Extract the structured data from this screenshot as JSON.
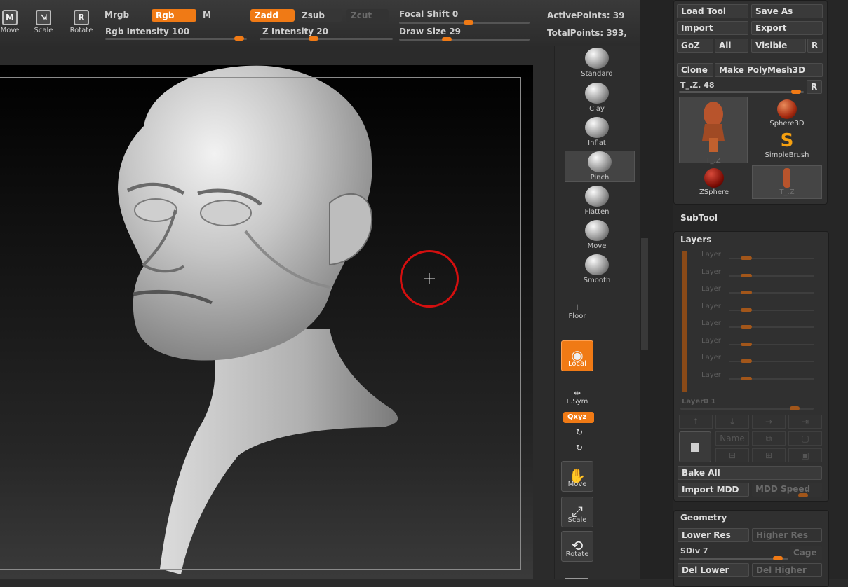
{
  "toolbar": {
    "move_label": "Move",
    "scale_label": "Scale",
    "rotate_label": "Rotate",
    "mrgb_label": "Mrgb",
    "rgb_label": "Rgb",
    "m_label": "M",
    "zadd_label": "Zadd",
    "zsub_label": "Zsub",
    "zcut_label": "Zcut",
    "rgb_intensity_label": "Rgb Intensity 100",
    "rgb_intensity_value": 100,
    "z_intensity_label": "Z Intensity 20",
    "z_intensity_value": 20,
    "focal_shift_label": "Focal Shift 0",
    "focal_shift_value": 0,
    "draw_size_label": "Draw Size 29",
    "draw_size_value": 29,
    "active_points_label": "ActivePoints: 39",
    "total_points_label": "TotalPoints: 393,"
  },
  "shelf": {
    "brushes": [
      {
        "name": "Standard"
      },
      {
        "name": "Clay"
      },
      {
        "name": "Inflat"
      },
      {
        "name": "Pinch"
      },
      {
        "name": "Flatten"
      },
      {
        "name": "Move"
      },
      {
        "name": "Smooth"
      }
    ],
    "floor_label": "Floor",
    "local_label": "Local",
    "lsym_label": "L.Sym",
    "xyz_label": "Qxyz",
    "move_label": "Move",
    "scale_label": "Scale",
    "rotate_label": "Rotate"
  },
  "palette": {
    "load_tool": "Load Tool",
    "save_as": "Save As",
    "import": "Import",
    "export": "Export",
    "goz": "GoZ",
    "all": "All",
    "visible": "Visible",
    "r": "R",
    "clone": "Clone",
    "make_polymesh": "Make PolyMesh3D",
    "tool_slider_label": "T_.Z. 48",
    "tool_slider_value": 48,
    "thumbs": {
      "current_tool": "T_.Z",
      "sphere3d": "Sphere3D",
      "simplebrush": "SimpleBrush",
      "zsphere": "ZSphere",
      "small_tool": "T_.Z"
    },
    "subtool": "SubTool",
    "layers": {
      "title": "Layers",
      "rows": [
        "Layer",
        "Layer",
        "Layer",
        "Layer",
        "Layer",
        "Layer",
        "Layer",
        "Layer"
      ],
      "layer_slider_label": "Layer0 1",
      "name_label": "Name"
    },
    "bake_all": "Bake All",
    "import_mdd": "Import MDD",
    "mdd_speed": "MDD Speed",
    "geometry": {
      "title": "Geometry",
      "lower_res": "Lower Res",
      "higher_res": "Higher Res",
      "sdiv_label": "SDiv 7",
      "sdiv_value": 7,
      "cage": "Cage",
      "del_lower": "Del Lower",
      "del_higher": "Del Higher"
    }
  },
  "colors": {
    "accent": "#f07a15",
    "cursor_ring": "#d40f0f"
  }
}
